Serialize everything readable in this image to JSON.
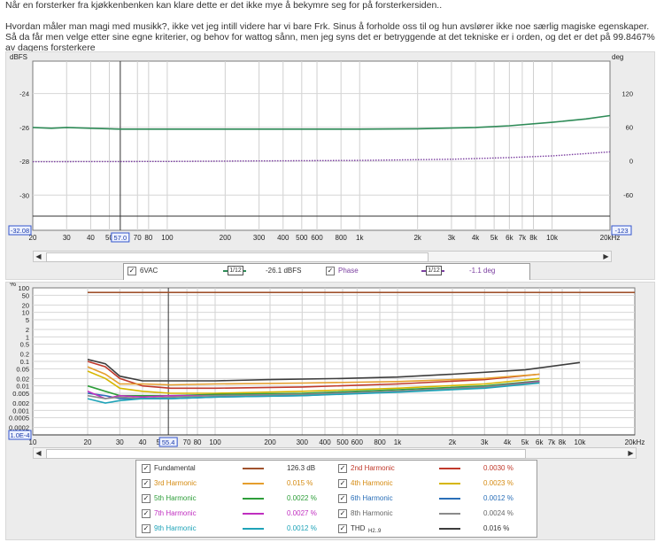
{
  "post": {
    "paragraph1": "Når en forsterker fra kjøkkenbenken kan klare dette er det ikke mye å bekymre seg for på forsterkersiden..",
    "paragraph2": "Hvordan måler man magi med musikk?, ikke vet jeg intill videre har vi bare Frk. Sinus å forholde oss til og hun avslører ikke noe særlig magiske egenskaper. Så da får men velge etter sine egne kriterier, og behov for wattog sånn, men jeg syns det er betryggende at det tekniske er i orden, og det er det på 99.8467% av dagens forsterkere"
  },
  "chart_data": [
    {
      "type": "line",
      "left_axis_label": "dBFS",
      "right_axis_label": "deg",
      "x_scale": "log",
      "xlim": [
        20,
        20000
      ],
      "ylim": [
        -32.08,
        -22.08
      ],
      "y2lim": [
        -123,
        177
      ],
      "x_ticks": [
        "20",
        "30",
        "40",
        "50",
        "70",
        "80",
        "100",
        "200",
        "300",
        "400",
        "500",
        "600",
        "800",
        "1k",
        "2k",
        "3k",
        "4k",
        "5k",
        "6k",
        "7k",
        "8k",
        "10k",
        "20kHz"
      ],
      "y_ticks": [
        "-24",
        "-26",
        "-28",
        "-30",
        "-32.08"
      ],
      "y2_ticks": [
        "120",
        "60",
        "0",
        "-60",
        "-123"
      ],
      "cursor": {
        "x": 57.0,
        "label": "57.0"
      },
      "grid": true,
      "legend_position": "bottom",
      "series": [
        {
          "name": "6VAC",
          "axis": "left",
          "color": "#2e8b57",
          "style": "solid",
          "x": [
            20,
            25,
            30,
            40,
            57,
            100,
            200,
            500,
            1000,
            2000,
            4000,
            6000,
            10000,
            15000,
            20000
          ],
          "y": [
            -26.0,
            -26.05,
            -26.0,
            -26.05,
            -26.1,
            -26.1,
            -26.1,
            -26.1,
            -26.1,
            -26.08,
            -26.0,
            -25.9,
            -25.7,
            -25.5,
            -25.3
          ]
        },
        {
          "name": "Phase",
          "axis": "right",
          "color": "#7b3fa0",
          "style": "dotted",
          "x": [
            20,
            30,
            57,
            100,
            300,
            1000,
            3000,
            6000,
            10000,
            15000,
            20000
          ],
          "y": [
            -1.5,
            -1.3,
            -1.1,
            -1.0,
            0,
            1,
            3,
            6,
            9,
            13,
            16
          ]
        }
      ]
    },
    {
      "type": "line",
      "left_axis_label": "%",
      "x_scale": "log",
      "y_scale": "log",
      "xlim": [
        10,
        20000
      ],
      "ylim": [
        0.0001,
        100
      ],
      "x_ticks": [
        "10",
        "20",
        "30",
        "40",
        "50",
        "70",
        "80",
        "100",
        "200",
        "300",
        "400",
        "500",
        "600",
        "800",
        "1k",
        "2k",
        "3k",
        "4k",
        "5k",
        "6k",
        "7k",
        "8k",
        "10k",
        "20kHz"
      ],
      "y_ticks": [
        "100",
        "50",
        "20",
        "10",
        "5",
        "2",
        "1",
        "0.5",
        "0.2",
        "0.1",
        "0.05",
        "0.02",
        "0.01",
        "0.005",
        "0.002",
        "0.001",
        "0.0005",
        "0.0002",
        "1.0E-4"
      ],
      "cursor": {
        "x": 55.4,
        "label": "55.4"
      },
      "grid": true,
      "legend_position": "bottom",
      "series": [
        {
          "name": "Fundamental",
          "value": "126.3 dB",
          "color": "#a0522d",
          "x": [
            20,
            20000
          ],
          "y": [
            65,
            65
          ]
        },
        {
          "name": "THD",
          "value": "0.016 %",
          "color": "#3d3d3d",
          "x": [
            20,
            25,
            30,
            40,
            57,
            100,
            200,
            500,
            1000,
            2000,
            5000,
            10000
          ],
          "y": [
            0.12,
            0.08,
            0.025,
            0.016,
            0.016,
            0.016,
            0.018,
            0.02,
            0.023,
            0.03,
            0.045,
            0.09
          ]
        },
        {
          "name": "2nd Harmonic",
          "value": "0.0030 %",
          "color": "#c0392b",
          "x": [
            20,
            25,
            30,
            40,
            57,
            100,
            300,
            1000,
            3000,
            6000
          ],
          "y": [
            0.1,
            0.06,
            0.02,
            0.01,
            0.008,
            0.008,
            0.009,
            0.012,
            0.018,
            0.03
          ]
        },
        {
          "name": "3rd Harmonic",
          "value": "0.015 %",
          "color": "#e59e2d",
          "x": [
            20,
            25,
            30,
            40,
            57,
            100,
            300,
            1000,
            3000,
            6000
          ],
          "y": [
            0.06,
            0.03,
            0.012,
            0.012,
            0.011,
            0.012,
            0.013,
            0.015,
            0.02,
            0.03
          ]
        },
        {
          "name": "4th Harmonic",
          "value": "0.0023 %",
          "color": "#d6b600",
          "x": [
            20,
            25,
            30,
            40,
            57,
            100,
            300,
            1000,
            3000,
            6000
          ],
          "y": [
            0.04,
            0.02,
            0.008,
            0.006,
            0.005,
            0.005,
            0.006,
            0.008,
            0.012,
            0.02
          ]
        },
        {
          "name": "5th Harmonic",
          "value": "0.0022 %",
          "color": "#2e9e3a",
          "x": [
            20,
            25,
            30,
            40,
            57,
            100,
            300,
            1000,
            3000,
            6000
          ],
          "y": [
            0.01,
            0.006,
            0.004,
            0.004,
            0.004,
            0.0045,
            0.005,
            0.007,
            0.01,
            0.016
          ]
        },
        {
          "name": "6th Harmonic",
          "value": "0.0012 %",
          "color": "#2a6fb8",
          "x": [
            20,
            25,
            30,
            40,
            57,
            100,
            300,
            1000,
            3000,
            6000
          ],
          "y": [
            0.005,
            0.004,
            0.003,
            0.003,
            0.003,
            0.0035,
            0.004,
            0.006,
            0.009,
            0.014
          ]
        },
        {
          "name": "7th Harmonic",
          "value": "0.0027 %",
          "color": "#c02fc0",
          "x": [
            20,
            25,
            30,
            40,
            57,
            100,
            300,
            1000,
            3000,
            6000
          ],
          "y": [
            0.006,
            0.003,
            0.004,
            0.0035,
            0.004,
            0.004,
            0.0045,
            0.006,
            0.009,
            0.015
          ]
        },
        {
          "name": "8th Harmonic",
          "value": "0.0024 %",
          "color": "#8a8a8a",
          "x": [
            20,
            25,
            30,
            40,
            57,
            100,
            300,
            1000,
            3000,
            6000
          ],
          "y": [
            0.004,
            0.003,
            0.0035,
            0.003,
            0.0035,
            0.004,
            0.0045,
            0.006,
            0.009,
            0.014
          ]
        },
        {
          "name": "9th Harmonic",
          "value": "0.0012 %",
          "color": "#1fa3b8",
          "x": [
            20,
            25,
            30,
            40,
            57,
            100,
            300,
            1000,
            3000,
            6000
          ],
          "y": [
            0.003,
            0.002,
            0.0025,
            0.003,
            0.003,
            0.0035,
            0.004,
            0.0055,
            0.008,
            0.013
          ]
        }
      ]
    }
  ],
  "legend1": {
    "rows": [
      {
        "name": "6VAC",
        "box": "1/12",
        "value": "-26.1 dBFS",
        "color": "#2e8b57"
      },
      {
        "name": "Phase",
        "box": "1/12",
        "value": "-1.1 deg",
        "color": "#7b3fa0"
      }
    ]
  },
  "legend2": {
    "left": [
      {
        "name": "Fundamental",
        "value": "126.3 dB",
        "color": "#a0522d",
        "text_color": "#333333"
      },
      {
        "name": "3rd Harmonic",
        "value": "0.015 %",
        "color": "#e59e2d",
        "text_color": "#d58b12"
      },
      {
        "name": "5th Harmonic",
        "value": "0.0022 %",
        "color": "#2e9e3a",
        "text_color": "#2e9e3a"
      },
      {
        "name": "7th Harmonic",
        "value": "0.0027 %",
        "color": "#c02fc0",
        "text_color": "#c02fc0"
      },
      {
        "name": "9th Harmonic",
        "value": "0.0012 %",
        "color": "#1fa3b8",
        "text_color": "#1fa3b8"
      }
    ],
    "right": [
      {
        "name": "2nd Harmonic",
        "value": "0.0030 %",
        "color": "#c0392b",
        "text_color": "#c0392b"
      },
      {
        "name": "4th Harmonic",
        "value": "0.0023 %",
        "color": "#d6b600",
        "text_color": "#d58b12"
      },
      {
        "name": "6th Harmonic",
        "value": "0.0012 %",
        "color": "#2a6fb8",
        "text_color": "#2a6fb8"
      },
      {
        "name": "8th Harmonic",
        "value": "0.0024 %",
        "color": "#8a8a8a",
        "text_color": "#666666"
      },
      {
        "name": "THD",
        "name_sub": "H2..9",
        "value": "0.016 %",
        "color": "#3d3d3d",
        "text_color": "#333333"
      }
    ]
  },
  "checkbox_mark": "✓",
  "scroll_left": "◀",
  "scroll_right": "▶"
}
